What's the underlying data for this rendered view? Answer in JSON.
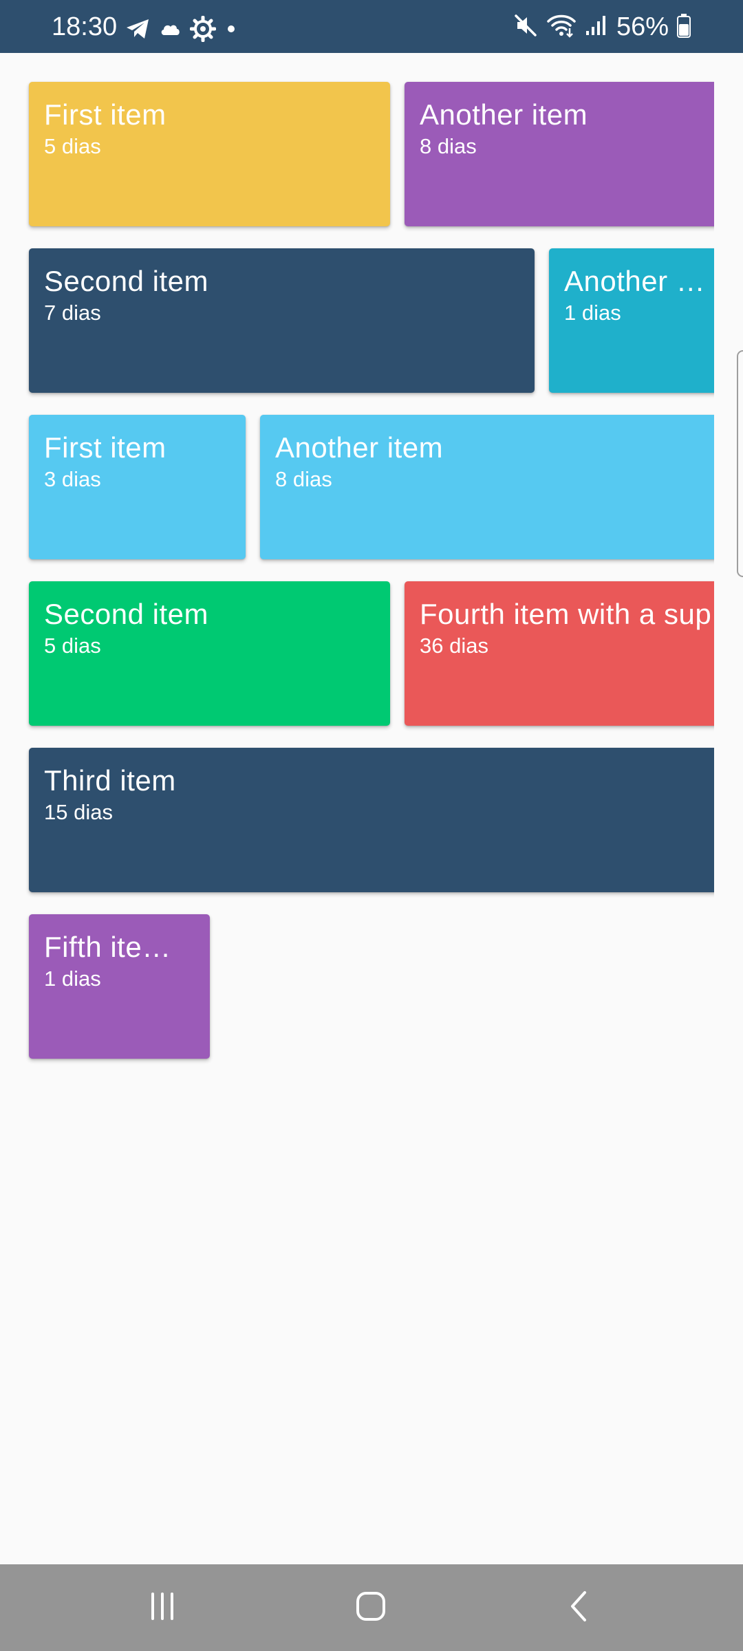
{
  "status_bar": {
    "time": "18:30",
    "battery": "56%",
    "background": "#2e4f6e",
    "left_icons": [
      "telegram-icon",
      "cloud-icon",
      "settings-gear-icon",
      "dot-icon"
    ],
    "right_icons": [
      "mute-icon",
      "wifi-icon",
      "signal-icon",
      "battery-icon"
    ]
  },
  "tiles": [
    {
      "title": "First item",
      "subtitle": "5 dias",
      "color": "#f2c54c"
    },
    {
      "title": "Another item",
      "subtitle": "8 dias",
      "color": "#9b5bb8"
    },
    {
      "title": "Second item",
      "subtitle": "7 dias",
      "color": "#2e4f6e"
    },
    {
      "title": "Another i…",
      "subtitle": "1 dias",
      "color": "#1fb0cb"
    },
    {
      "title": "First item",
      "subtitle": "3 dias",
      "color": "#56c9f1"
    },
    {
      "title": "Another item",
      "subtitle": "8 dias",
      "color": "#56c9f1"
    },
    {
      "title": "Second item",
      "subtitle": "5 dias",
      "color": "#00c972"
    },
    {
      "title": "Fourth item with a sup",
      "subtitle": "36 dias",
      "color": "#ea5858"
    },
    {
      "title": "Third item",
      "subtitle": "15 dias",
      "color": "#2e4f6e"
    },
    {
      "title": "Fifth ite…",
      "subtitle": "1 dias",
      "color": "#9b5bb8"
    }
  ],
  "nav_bar": {
    "background": "#959595",
    "buttons": [
      "recent-apps-icon",
      "home-icon",
      "back-icon"
    ]
  }
}
